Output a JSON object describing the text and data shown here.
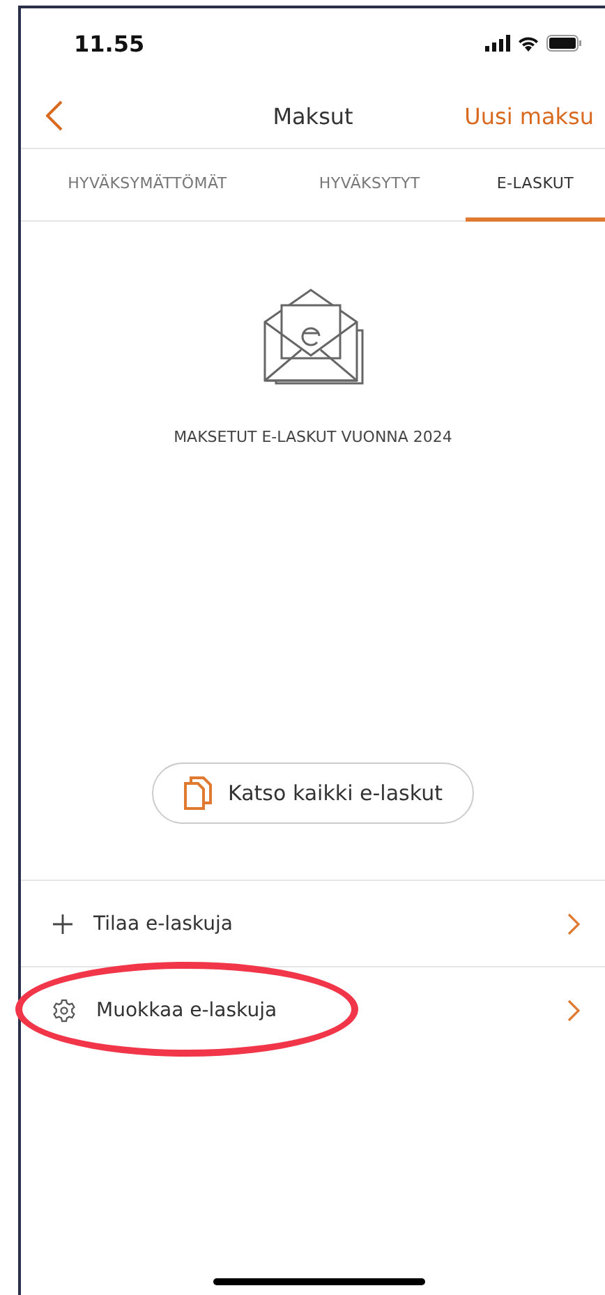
{
  "status_bar": {
    "time": "11.55"
  },
  "nav": {
    "title": "Maksut",
    "action": "Uusi maksu"
  },
  "tabs": [
    {
      "label": "HYVÄKSYMÄTTÖMÄT",
      "selected": false
    },
    {
      "label": "HYVÄKSYTYT",
      "selected": false
    },
    {
      "label": "E-LASKUT",
      "selected": true
    }
  ],
  "summary": {
    "caption": "MAKSETUT E-LASKUT VUONNA 2024"
  },
  "view_all_button": {
    "label": "Katso kaikki e-laskut"
  },
  "rows": [
    {
      "kind": "add",
      "label": "Tilaa e-laskuja",
      "circled": false
    },
    {
      "kind": "settings",
      "label": "Muokkaa e-laskuja",
      "circled": true
    }
  ]
}
